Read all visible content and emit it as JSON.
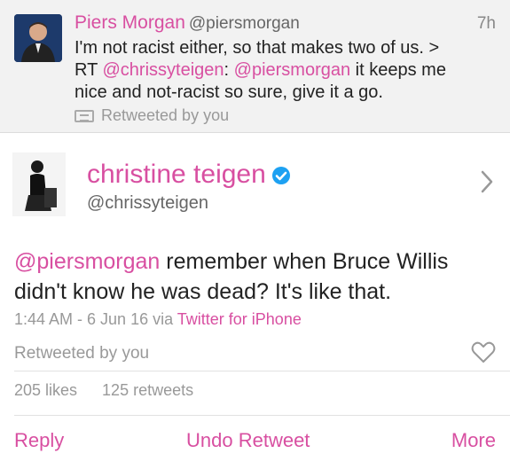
{
  "top_tweet": {
    "name": "Piers Morgan",
    "handle": "@piersmorgan",
    "time": "7h",
    "line1": "I'm not racist either, so that makes two of us. >",
    "rt_prefix": "RT ",
    "mention1": "@chrissyteigen",
    "colon": ": ",
    "mention2": "@piersmorgan",
    "rest1": " it keeps me",
    "line3": "nice and not-racist so sure, give it a go.",
    "retweeted_label": "Retweeted by you"
  },
  "main_tweet": {
    "name": "christine teigen",
    "handle": "@chrissyteigen",
    "mention": "@piersmorgan",
    "text_after_mention": " remember when Bruce Willis",
    "text_line2": "didn't know he was dead? It's like that.",
    "timestamp": "1:44 AM - 6 Jun 16 via ",
    "source": "Twitter for iPhone",
    "retweeted_label": "Retweeted by you",
    "likes": "205 likes",
    "retweets": "125 retweets"
  },
  "actions": {
    "reply": "Reply",
    "undo_retweet": "Undo Retweet",
    "more": "More"
  },
  "colors": {
    "accent": "#d84fa1",
    "verified": "#1da1f2"
  }
}
